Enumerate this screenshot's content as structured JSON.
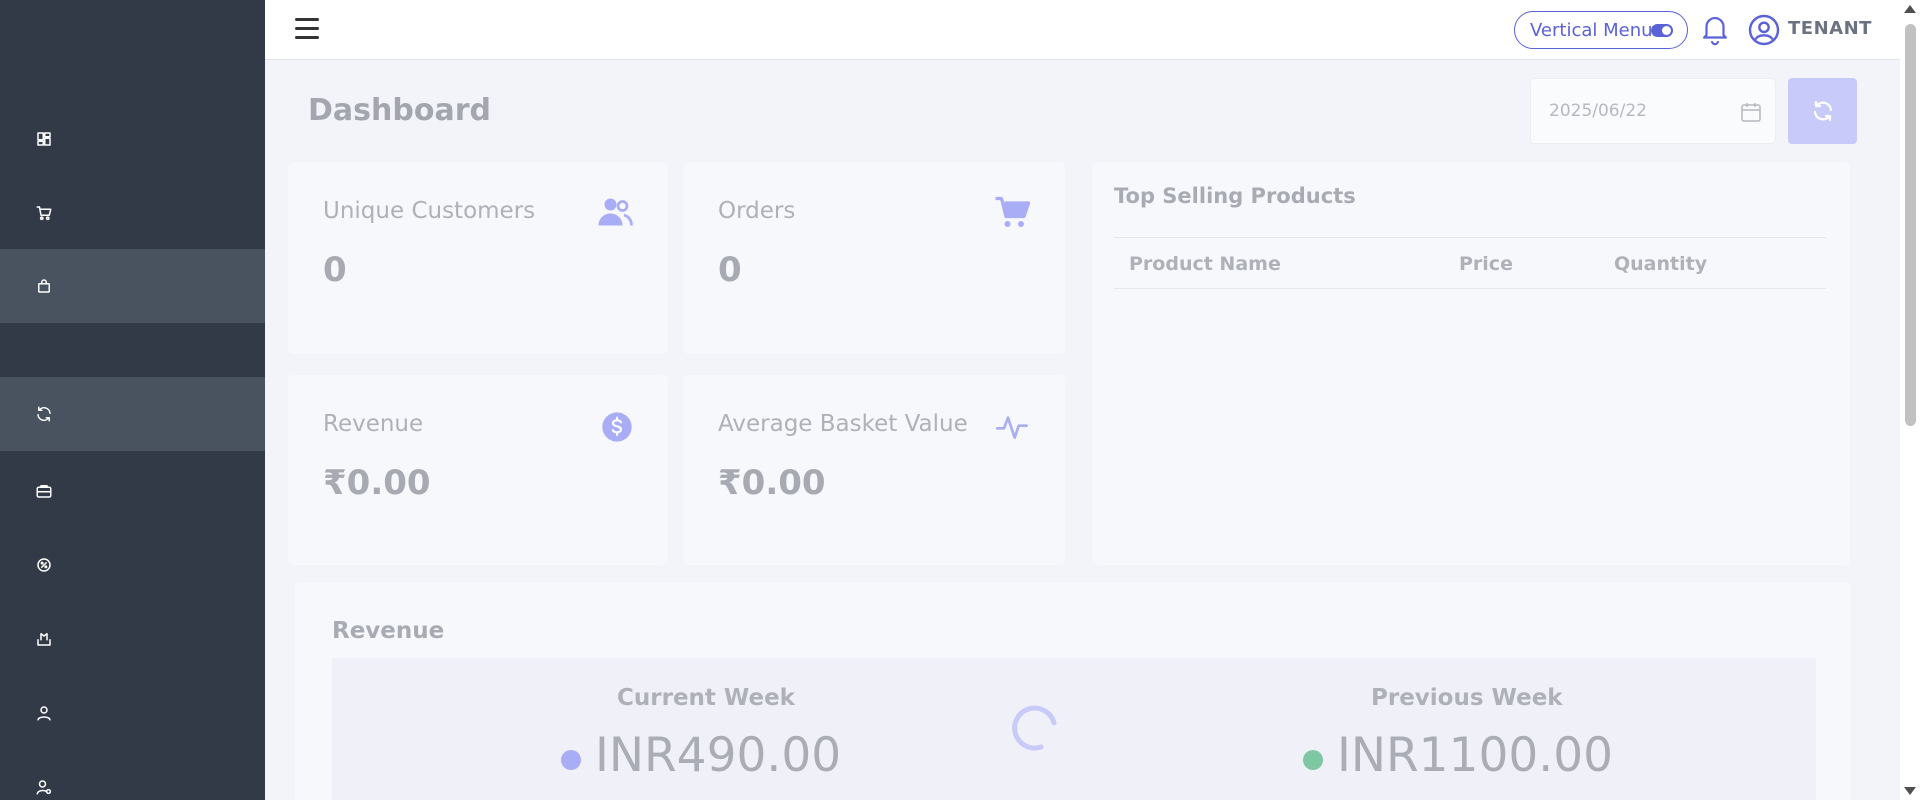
{
  "topbar": {
    "menu_toggle_label": "Vertical Menu",
    "user_label": "TENANT"
  },
  "page": {
    "title": "Dashboard",
    "date_value": "2025/06/22"
  },
  "stats": {
    "unique_customers": {
      "label": "Unique Customers",
      "value": "0"
    },
    "orders": {
      "label": "Orders",
      "value": "0"
    },
    "revenue": {
      "label": "Revenue",
      "value": "₹0.00"
    },
    "avg_basket": {
      "label": "Average Basket Value",
      "value": "₹0.00"
    }
  },
  "top_selling": {
    "title": "Top Selling Products",
    "columns": [
      "Product Name",
      "Price",
      "Quantity"
    ]
  },
  "revenue_panel": {
    "title": "Revenue",
    "current_week": {
      "label": "Current Week",
      "value": "INR490.00",
      "color": "#a9adf5"
    },
    "previous_week": {
      "label": "Previous Week",
      "value": "INR1100.00",
      "color": "#7dc8a3"
    }
  },
  "sidebar": {
    "items": [
      {
        "icon": "dashboard-icon"
      },
      {
        "icon": "cart-icon"
      },
      {
        "icon": "bag-icon",
        "active": true
      },
      {
        "icon": "refresh-icon",
        "active": true
      },
      {
        "icon": "briefcase-icon"
      },
      {
        "icon": "settings-badge-icon"
      },
      {
        "icon": "export-icon"
      },
      {
        "icon": "user-icon"
      },
      {
        "icon": "user-settings-icon"
      }
    ]
  },
  "colors": {
    "accent": "#5b61d6",
    "sidebar_bg": "#323a47",
    "icon_accent": "#a9adf5"
  }
}
